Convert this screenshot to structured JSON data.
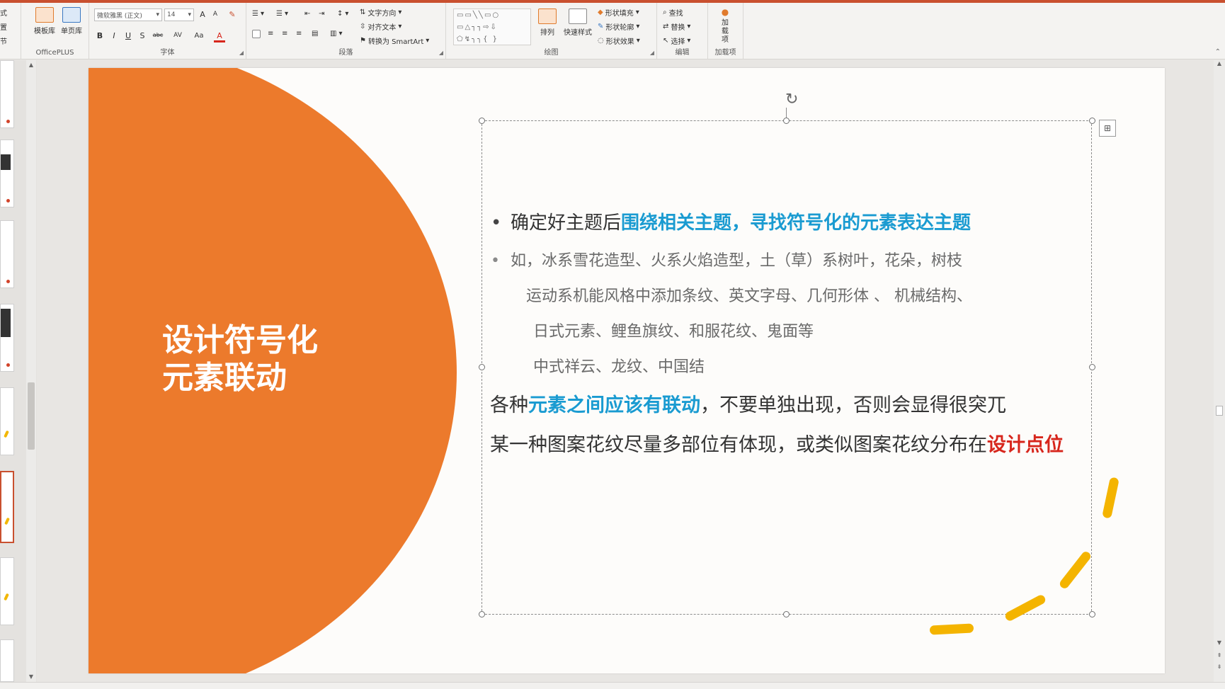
{
  "ribbon": {
    "left_clip": [
      "式",
      "置",
      "节"
    ],
    "officeplus": {
      "btn1": "模板库",
      "btn2": "单页库",
      "label": "OfficePLUS"
    },
    "font": {
      "font_name": "微软雅黑 (正文)",
      "font_size": "14",
      "grow": "A",
      "shrink": "A",
      "bold": "B",
      "italic": "I",
      "underline": "U",
      "shadow": "S",
      "strike": "abc",
      "spacing": "AV",
      "case": "Aa",
      "color": "A",
      "label": "字体"
    },
    "paragraph": {
      "text_direction": "文字方向",
      "align_text": "对齐文本",
      "smartart": "转换为 SmartArt",
      "label": "段落"
    },
    "drawing": {
      "arrange": "排列",
      "quick_styles": "快速样式",
      "shape_fill": "形状填充",
      "shape_outline": "形状轮廓",
      "shape_effects": "形状效果",
      "label": "绘图"
    },
    "editing": {
      "find": "查找",
      "replace": "替换",
      "select": "选择",
      "label": "编辑"
    },
    "addins": {
      "btn": "加载项",
      "label": "加载项"
    }
  },
  "slide": {
    "title_line1": "设计符号化",
    "title_line2": "元素联动",
    "bullet1": {
      "prefix": "确定好主题后",
      "highlight": "围绕相关主题，寻找符号化的元素表达主题"
    },
    "bullet2": "如，冰系雪花造型、火系火焰造型，土（草）系树叶，花朵，树枝",
    "sub1": "运动系机能风格中添加条纹、英文字母、几何形体  、 机械结构、",
    "sub2": "日式元素、鲤鱼旗纹、和服花纹、鬼面等",
    "sub3": "中式祥云、龙纹、中国结",
    "para1": {
      "prefix": "各种",
      "highlight": "元素之间应该有联动",
      "suffix": "，不要单独出现，否则会显得很突兀"
    },
    "para2": {
      "prefix": "某一种图案花纹尽量多部位有体现，或类似图案花纹分布在",
      "highlight": "设计点位"
    }
  },
  "colors": {
    "circle": "#ec7a2c",
    "highlight_blue": "#1a9bd1",
    "highlight_red": "#d7261c",
    "decoration_yellow": "#f4b400"
  }
}
